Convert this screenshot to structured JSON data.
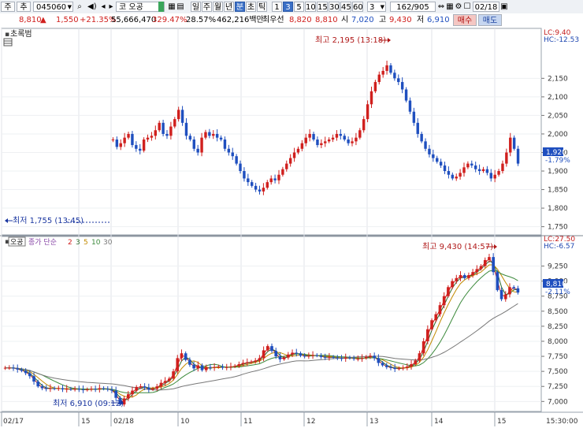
{
  "toolbar": {
    "mode1": "주",
    "mode2": "추",
    "code": "045060",
    "name": "코 오공",
    "periods": [
      "일",
      "주",
      "월",
      "년",
      "분",
      "초",
      "틱"
    ],
    "period_selected": "분",
    "intervals": [
      "1",
      "3",
      "5",
      "10",
      "15",
      "30",
      "45",
      "60"
    ],
    "interval_selected": "3",
    "interval_input": "3",
    "count": "162",
    "count_total": "/905",
    "date": "02/18",
    "btn_buy": "매수",
    "btn_sell": "매도"
  },
  "info": {
    "price": "8,810",
    "change_arrow": "▲",
    "change": "1,550",
    "change_pct": "+21.35%",
    "volume": "55,666,470",
    "vol_ratio1": "329.47%",
    "vol_ratio2": "28.57%",
    "amount": "462,216백만",
    "ask_label": "최우선",
    "ask1": "8,820",
    "bid1": "8,810",
    "open_label": "시",
    "open": "7,020",
    "high_label": "고",
    "high": "9,430",
    "low_label": "저",
    "low": "6,910"
  },
  "upper_panel": {
    "legend": "초록범",
    "lc_label": "LC:9.40",
    "hc_label": "HC:-12.53",
    "price_box": "1,920",
    "price_pct": "-1.79%",
    "high_annot": "최고 2,195 (13:18)",
    "low_annot": "최저 1,755 (13:45)"
  },
  "lower_panel": {
    "legend_box": "오공",
    "legend_ma": "종가 단순",
    "ma_periods": [
      "2",
      "3",
      "5",
      "10",
      "30"
    ],
    "lc_label": "LC:27.50",
    "hc_label": "HC:-6.57",
    "price_box": "8,810",
    "price_pct": "-2.11%",
    "high_annot": "최고 9,430 (14:57)",
    "low_annot": "최저 6,910 (09:12)"
  },
  "x_axis": {
    "labels": [
      "02/17",
      "15",
      "02/18",
      "10",
      "11",
      "12",
      "13",
      "14",
      "15"
    ],
    "time_label": "15:30:00"
  },
  "chart_data": [
    {
      "type": "candlestick",
      "title": "초록범",
      "y_ticks": [
        1750,
        1800,
        1850,
        1900,
        1950,
        2000,
        2050,
        2100,
        2150
      ],
      "ylim": [
        1730,
        2240
      ],
      "current": 1920,
      "annotations": [
        {
          "label": "최고 2,195 (13:18)",
          "value": 2195
        },
        {
          "label": "최저 1,755 (13:45)",
          "value": 1755
        }
      ],
      "closes": [
        1985,
        1965,
        1975,
        1990,
        2000,
        1970,
        1960,
        1955,
        1985,
        1990,
        1995,
        2010,
        2030,
        2000,
        1995,
        2020,
        2040,
        2065,
        2030,
        1995,
        1985,
        1960,
        1950,
        1990,
        2005,
        1995,
        2000,
        1990,
        1985,
        1960,
        1950,
        1940,
        1920,
        1900,
        1880,
        1870,
        1860,
        1850,
        1845,
        1855,
        1870,
        1880,
        1875,
        1890,
        1905,
        1920,
        1935,
        1950,
        1960,
        1975,
        1990,
        2000,
        1985,
        1970,
        1975,
        1980,
        1985,
        1990,
        2000,
        1995,
        1985,
        1975,
        1980,
        1990,
        2010,
        2040,
        2080,
        2115,
        2140,
        2160,
        2170,
        2185,
        2165,
        2150,
        2140,
        2120,
        2090,
        2060,
        2030,
        2000,
        1980,
        1960,
        1945,
        1935,
        1925,
        1915,
        1900,
        1890,
        1880,
        1885,
        1895,
        1910,
        1920,
        1915,
        1905,
        1900,
        1905,
        1895,
        1880,
        1890,
        1900,
        1920,
        1950,
        1990,
        1960,
        1920
      ]
    },
    {
      "type": "candlestick",
      "title": "오공",
      "series": [
        {
          "name": "2"
        },
        {
          "name": "3"
        },
        {
          "name": "5"
        },
        {
          "name": "10"
        },
        {
          "name": "30"
        }
      ],
      "y_ticks": [
        7000,
        7250,
        7500,
        7750,
        8000,
        8250,
        8500,
        8750,
        9000,
        9250
      ],
      "ylim": [
        6860,
        9480
      ],
      "current": 8810,
      "annotations": [
        {
          "label": "최고 9,430 (14:57)",
          "value": 9430
        },
        {
          "label": "최저 6,910 (09:12)",
          "value": 6910
        }
      ],
      "closes": [
        7560,
        7560,
        7550,
        7530,
        7510,
        7470,
        7420,
        7330,
        7250,
        7220,
        7210,
        7220,
        7210,
        7220,
        7200,
        7210,
        7200,
        7210,
        7200,
        7190,
        7200,
        7210,
        7200,
        7220,
        7210,
        7200,
        7180,
        7060,
        6950,
        7050,
        7120,
        7180,
        7240,
        7250,
        7230,
        7200,
        7210,
        7250,
        7310,
        7340,
        7380,
        7500,
        7720,
        7800,
        7690,
        7610,
        7550,
        7600,
        7520,
        7570,
        7560,
        7570,
        7580,
        7560,
        7570,
        7580,
        7590,
        7620,
        7640,
        7650,
        7660,
        7680,
        7720,
        7850,
        7920,
        7840,
        7750,
        7700,
        7730,
        7780,
        7810,
        7800,
        7760,
        7750,
        7760,
        7770,
        7760,
        7740,
        7730,
        7740,
        7730,
        7720,
        7710,
        7730,
        7720,
        7710,
        7710,
        7720,
        7740,
        7760,
        7720,
        7640,
        7600,
        7570,
        7560,
        7540,
        7550,
        7560,
        7580,
        7620,
        7680,
        7800,
        8000,
        8200,
        8350,
        8450,
        8600,
        8750,
        8900,
        9000,
        9050,
        9100,
        9050,
        9100,
        9150,
        9200,
        9250,
        9350,
        9400,
        9150,
        8850,
        8700,
        8780,
        8900,
        8880,
        8810
      ]
    }
  ]
}
